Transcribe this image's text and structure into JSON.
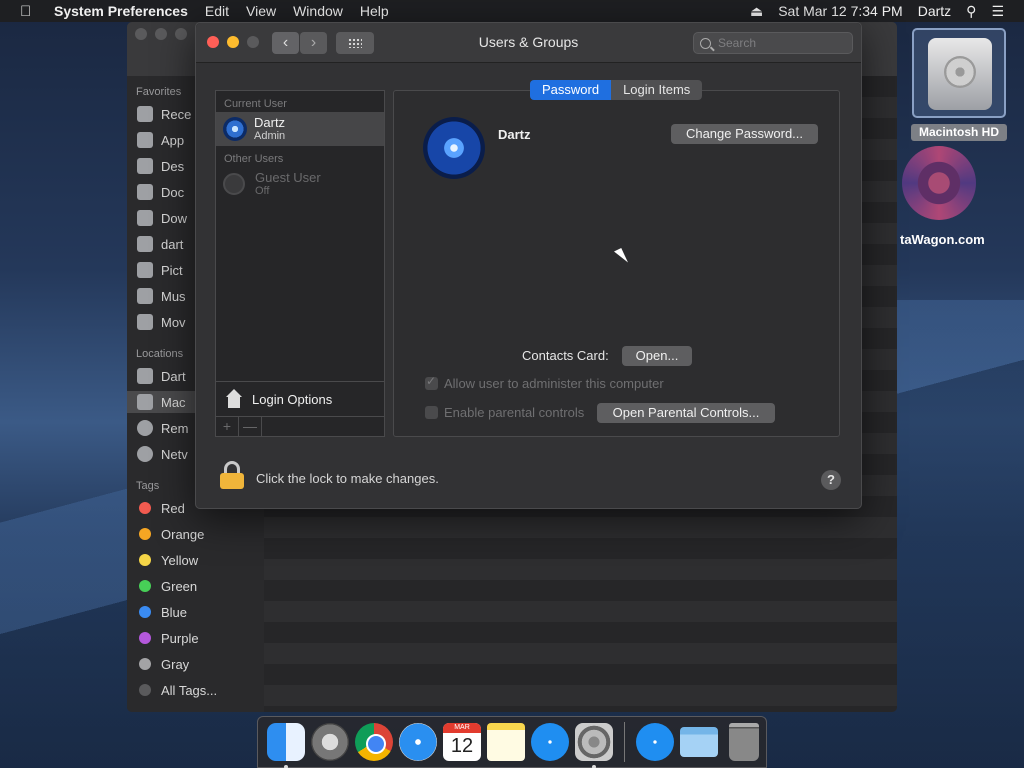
{
  "menubar": {
    "apple_icon": "apple-icon",
    "app_name": "System Preferences",
    "menus": [
      "Edit",
      "View",
      "Window",
      "Help"
    ],
    "eject_icon": "eject-icon",
    "datetime": "Sat Mar 12  7:34 PM",
    "user": "Dartz",
    "search_icon": "spotlight-icon",
    "list_icon": "notification-center-icon"
  },
  "finder": {
    "sections": {
      "favorites": "Favorites",
      "locations": "Locations",
      "tags": "Tags"
    },
    "favorites": [
      "Rece",
      "App",
      "Des",
      "Doc",
      "Dow",
      "dart",
      "Pict",
      "Mus",
      "Mov"
    ],
    "locations": [
      "Dart",
      "Mac",
      "Rem",
      "Netv"
    ],
    "tags": [
      {
        "label": "Red",
        "color": "#f25b50"
      },
      {
        "label": "Orange",
        "color": "#f6a623"
      },
      {
        "label": "Yellow",
        "color": "#f5d547"
      },
      {
        "label": "Green",
        "color": "#47cf57"
      },
      {
        "label": "Blue",
        "color": "#3a8bf2"
      },
      {
        "label": "Purple",
        "color": "#b458dc"
      },
      {
        "label": "Gray",
        "color": "#a3a3a5"
      },
      {
        "label": "All Tags...",
        "color": "#5a5a5c"
      }
    ]
  },
  "desktop": {
    "disk_label": "Macintosh HD",
    "partial_text": "taWagon.com"
  },
  "window": {
    "title": "Users & Groups",
    "search_placeholder": "Search"
  },
  "user_list": {
    "current_user_header": "Current User",
    "current_user": {
      "name": "Dartz",
      "role": "Admin"
    },
    "other_users_header": "Other Users",
    "guest_user": {
      "name": "Guest User",
      "status": "Off"
    },
    "login_options": "Login Options",
    "add": "+",
    "remove": "—"
  },
  "detail": {
    "tabs": [
      "Password",
      "Login Items"
    ],
    "active_tab": "Password",
    "username": "Dartz",
    "change_password": "Change Password...",
    "contacts_label": "Contacts Card:",
    "open_button": "Open...",
    "allow_admin": "Allow user to administer this computer",
    "allow_admin_checked": true,
    "parental_controls": "Enable parental controls",
    "parental_checked": false,
    "open_parental": "Open Parental Controls..."
  },
  "lock": {
    "text": "Click the lock to make changes.",
    "help": "?"
  },
  "dock": {
    "apps": [
      "Finder",
      "Launchpad",
      "Google Chrome",
      "Safari",
      "Calendar",
      "Notes",
      "App Store",
      "System Preferences"
    ],
    "calendar_month": "MAR",
    "calendar_day": "12",
    "extras": [
      "App Store Downloads",
      "Downloads Folder",
      "Trash"
    ]
  }
}
